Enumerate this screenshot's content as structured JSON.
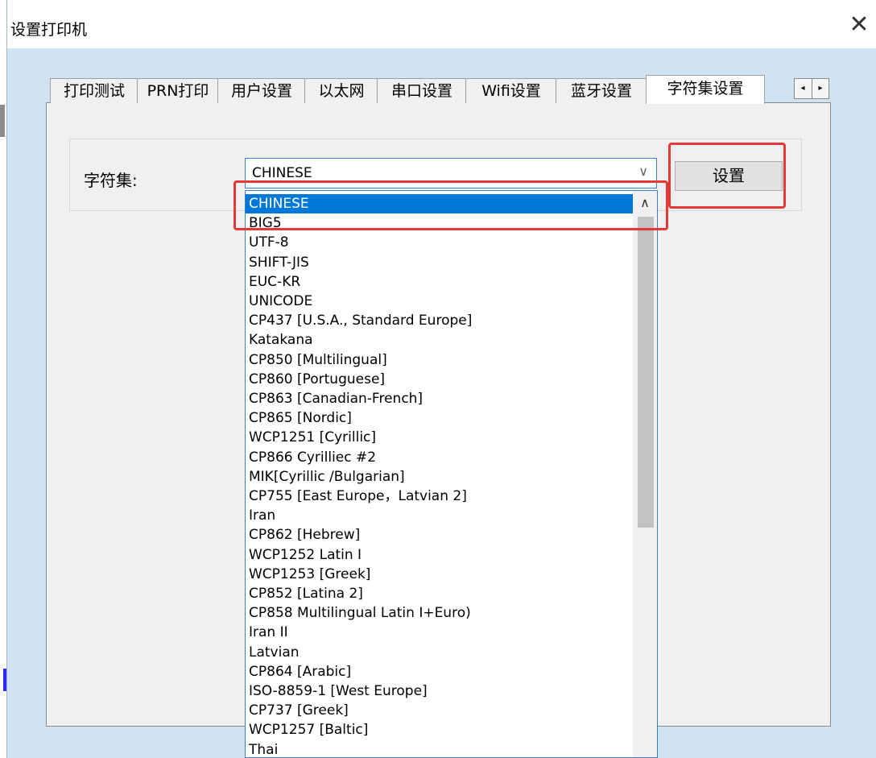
{
  "window": {
    "title": "设置打印机",
    "close_label": "✕"
  },
  "tabs": [
    {
      "label": "打印测试",
      "active": false
    },
    {
      "label": "PRN打印",
      "active": false
    },
    {
      "label": "用户设置",
      "active": false
    },
    {
      "label": "以太网",
      "active": false
    },
    {
      "label": "串口设置",
      "active": false
    },
    {
      "label": "Wifi设置",
      "active": false
    },
    {
      "label": "蓝牙设置",
      "active": false
    },
    {
      "label": "字符集设置",
      "active": true
    }
  ],
  "tab_scroll": {
    "left": "◂",
    "right": "▸"
  },
  "charset": {
    "label": "字符集:",
    "selected": "CHINESE",
    "button_label": "设置",
    "options": [
      "CHINESE",
      "BIG5",
      "UTF-8",
      "SHIFT-JIS",
      "EUC-KR",
      "UNICODE",
      "CP437 [U.S.A., Standard Europe]",
      "Katakana",
      "CP850 [Multilingual]",
      "CP860 [Portuguese]",
      "CP863 [Canadian-French]",
      "CP865 [Nordic]",
      "WCP1251 [Cyrillic]",
      "CP866 Cyrilliec #2",
      "MIK[Cyrillic /Bulgarian]",
      "CP755 [East Europe，Latvian 2]",
      "Iran",
      "CP862 [Hebrew]",
      "WCP1252 Latin I",
      "WCP1253 [Greek]",
      "CP852 [Latina 2]",
      "CP858 Multilingual Latin I+Euro)",
      "Iran II",
      "Latvian",
      "CP864 [Arabic]",
      "ISO-8859-1 [West Europe]",
      "CP737 [Greek]",
      "WCP1257 [Baltic]",
      "Thai"
    ]
  },
  "colors": {
    "highlight": "#e53935",
    "selection": "#0078d7",
    "window_bg": "#cfe3f3"
  }
}
